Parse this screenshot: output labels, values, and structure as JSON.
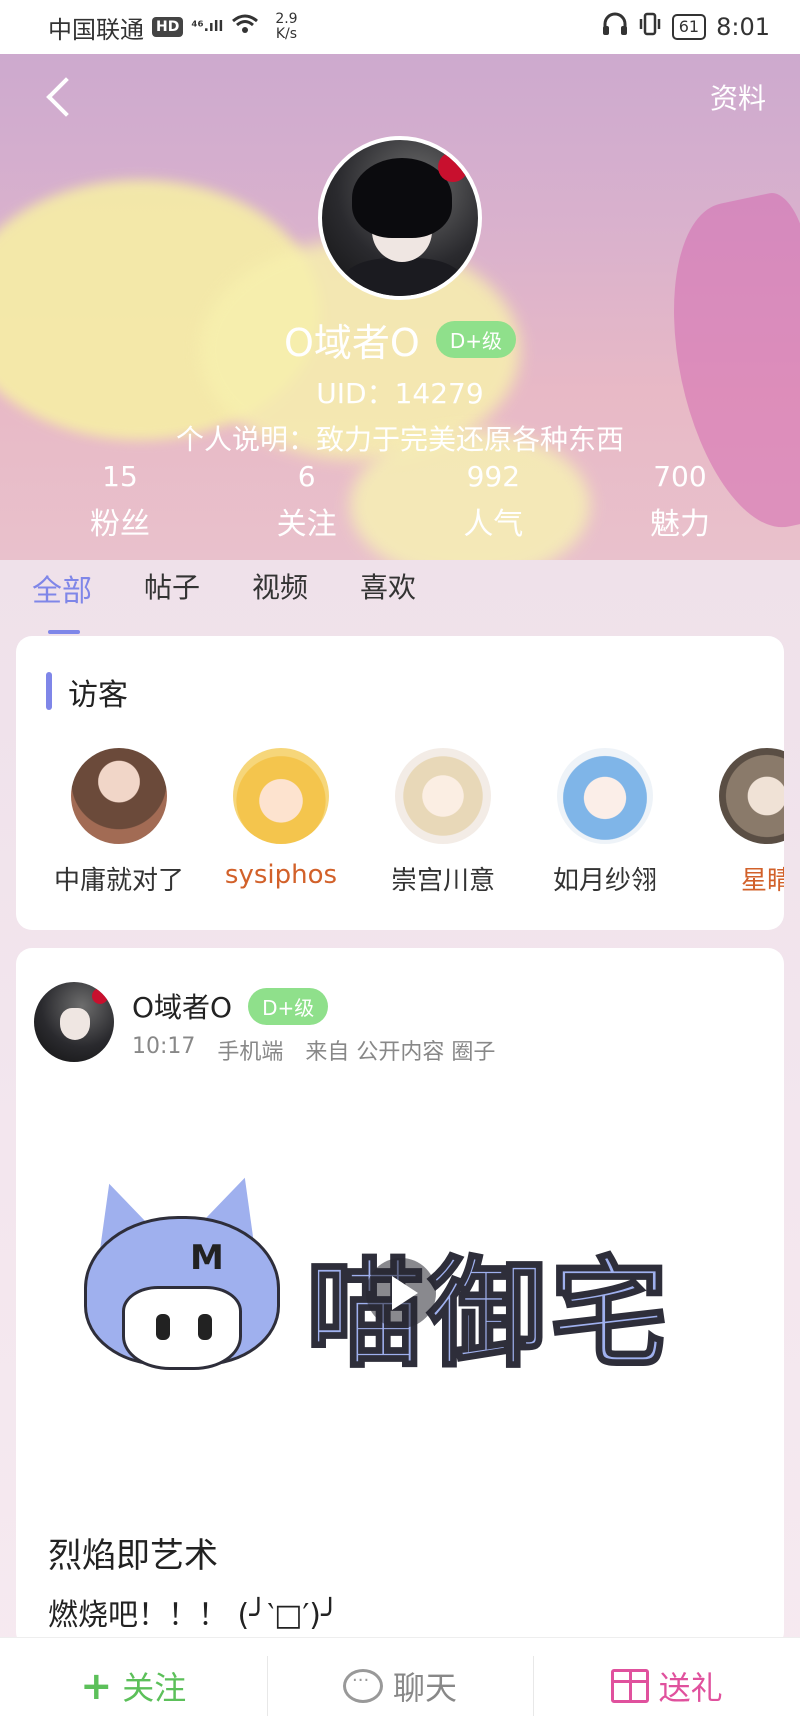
{
  "status_bar": {
    "carrier": "中国联通",
    "hd": "HD",
    "network": "⁴⁶.ıll",
    "netspeed_value": "2.9",
    "netspeed_unit": "K/s",
    "battery": "61",
    "time": "8:01"
  },
  "header": {
    "profile_link": "资料"
  },
  "profile": {
    "username": "O域者O",
    "level": "D+级",
    "uid": "UID：14279",
    "bio": "个人说明：致力于完美还原各种东西",
    "stats": [
      {
        "value": "15",
        "label": "粉丝"
      },
      {
        "value": "6",
        "label": "关注"
      },
      {
        "value": "992",
        "label": "人气"
      },
      {
        "value": "700",
        "label": "魅力"
      }
    ]
  },
  "tabs": [
    {
      "label": "全部",
      "active": true
    },
    {
      "label": "帖子",
      "active": false
    },
    {
      "label": "视频",
      "active": false
    },
    {
      "label": "喜欢",
      "active": false
    }
  ],
  "visitors": {
    "title": "访客",
    "items": [
      {
        "name": "中庸就对了"
      },
      {
        "name": "sysiphos"
      },
      {
        "name": "崇宫川意"
      },
      {
        "name": "如月纱翎"
      },
      {
        "name": "星睛"
      }
    ]
  },
  "post": {
    "author": "O域者O",
    "level": "D+级",
    "time": "10:17",
    "device": "手机端",
    "source": "来自 公开内容 圈子",
    "video_brand": "喵御宅",
    "title": "烈焰即艺术",
    "body": "燃烧吧！！！ (╯‵□′)╯"
  },
  "bottom_bar": {
    "follow": "关注",
    "chat": "聊天",
    "gift": "送礼"
  },
  "colors": {
    "accent": "#7f86e8",
    "level_badge": "#8fe08b",
    "follow": "#5cc05a",
    "gift": "#e0519d",
    "highlight_name": "#d2612a"
  }
}
